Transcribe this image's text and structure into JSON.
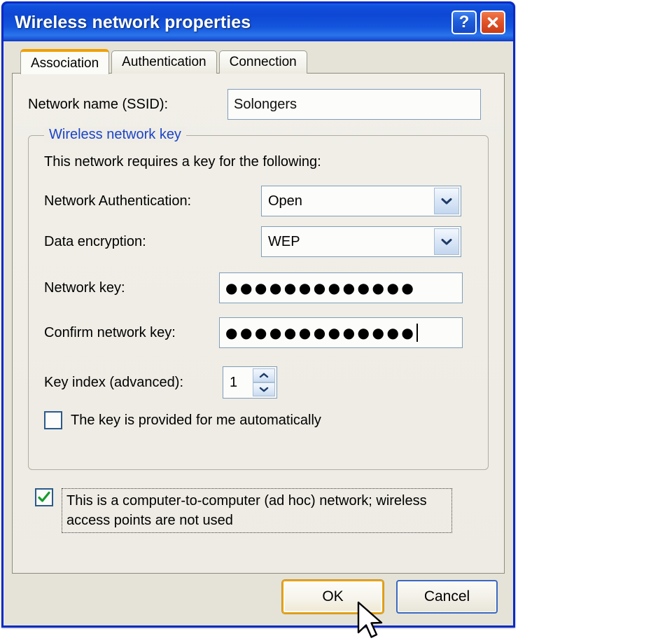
{
  "window": {
    "title": "Wireless network properties",
    "help_button": "?",
    "close_button": "×"
  },
  "tabs": [
    {
      "label": "Association",
      "active": true
    },
    {
      "label": "Authentication",
      "active": false
    },
    {
      "label": "Connection",
      "active": false
    }
  ],
  "association": {
    "ssid_label": "Network name (SSID):",
    "ssid_value": "Solongers",
    "group": {
      "legend": "Wireless network key",
      "note": "This network requires a key for the following:",
      "auth_label": "Network Authentication:",
      "auth_value": "Open",
      "encryption_label": "Data encryption:",
      "encryption_value": "WEP",
      "network_key_label": "Network key:",
      "network_key_value": "●●●●●●●●●●●●●",
      "confirm_key_label": "Confirm network key:",
      "confirm_key_value": "●●●●●●●●●●●●●",
      "key_index_label": "Key index (advanced):",
      "key_index_value": "1",
      "auto_key_label": "The key is provided for me automatically",
      "auto_key_checked": false
    },
    "adhoc_label": "This is a computer-to-computer (ad hoc) network; wireless access points are not used",
    "adhoc_checked": true
  },
  "buttons": {
    "ok": "OK",
    "cancel": "Cancel"
  },
  "colors": {
    "titlebar_blue": "#0d47d4",
    "window_border": "#0a2ac8",
    "group_legend_blue": "#1a44c8",
    "active_tab_accent": "#f0a000",
    "default_button_accent": "#e8a317",
    "checkbox_check": "#159b2e",
    "face": "#e5e3d8"
  }
}
